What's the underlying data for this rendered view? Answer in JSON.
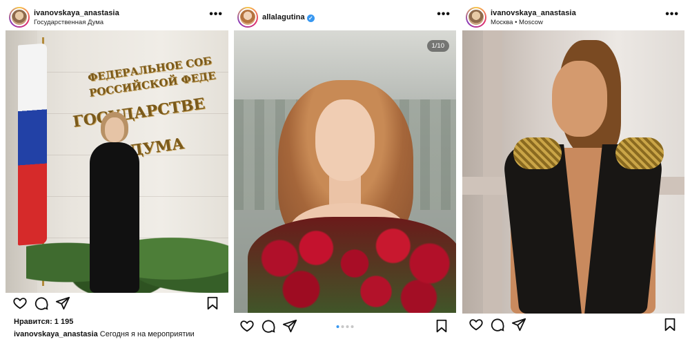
{
  "posts": [
    {
      "username": "ivanovskaya_anastasia",
      "location": "Государственная Дума",
      "more_icon": "more-horizontal-icon",
      "photo": {
        "sign_lines": [
          "ФЕДЕРАЛЬНОЕ СОБ",
          "РОССИЙСКОЙ ФЕДЕ",
          "ГОСУДАРСТВЕ",
          "ДУМА"
        ]
      },
      "likes_label": "Нравится: 1 195",
      "caption_user": "ivanovskaya_anastasia",
      "caption_text": "Сегодня я на мероприятии"
    },
    {
      "username": "allalagutina",
      "verified": true,
      "image_counter": "1/10",
      "carousel_dots": 4,
      "carousel_active": 0
    },
    {
      "username": "ivanovskaya_anastasia",
      "location": "Москва • Moscow"
    }
  ],
  "icons": {
    "like": "heart-icon",
    "comment": "comment-icon",
    "share": "send-icon",
    "save": "bookmark-icon"
  },
  "colors": {
    "verified": "#3897f0",
    "carousel_active": "#3897f0",
    "text": "#111111"
  }
}
